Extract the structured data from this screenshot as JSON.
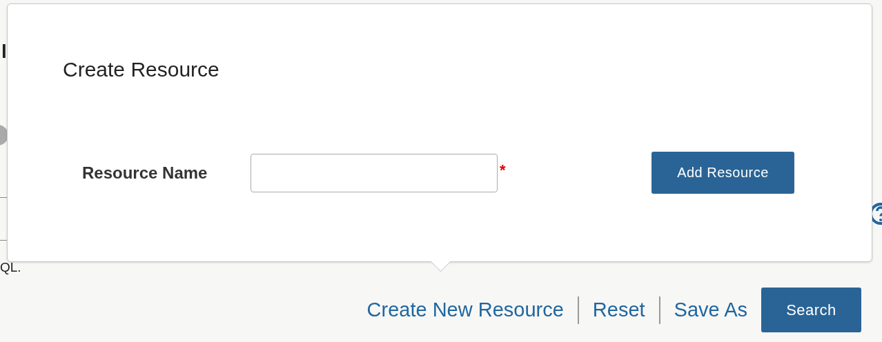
{
  "background": {
    "heading_fragment": "l",
    "note_fragment": "QL."
  },
  "popover": {
    "title": "Create Resource",
    "field": {
      "label": "Resource Name",
      "required_mark": "*"
    },
    "submit": "Add Resource"
  },
  "actions": {
    "links": [
      "Create New Resource",
      "Reset",
      "Save As"
    ],
    "button": "Search"
  }
}
